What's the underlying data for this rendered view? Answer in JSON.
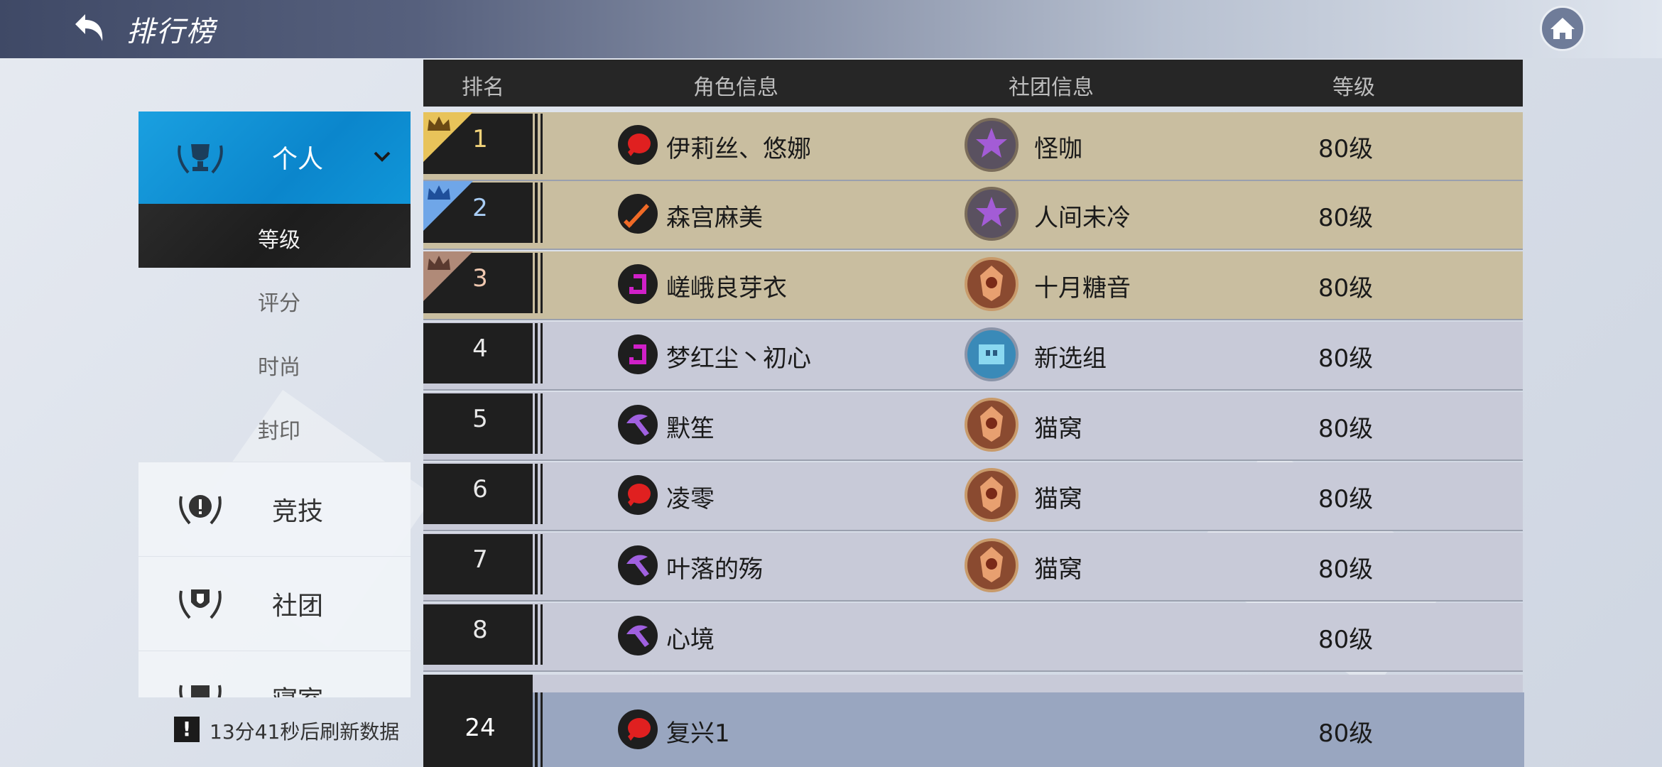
{
  "header": {
    "title": "排行榜",
    "back_icon": "back-arrow-icon",
    "home_icon": "home-icon"
  },
  "sidebar": {
    "personal_label": "个人",
    "subitems": [
      "等级",
      "评分",
      "时尚",
      "封印"
    ],
    "active_subitem": "等级",
    "categories": [
      "竞技",
      "社团",
      "寝室"
    ],
    "refresh_text": "13分41秒后刷新数据",
    "refresh_icon_text": "!"
  },
  "table": {
    "headers": {
      "rank": "排名",
      "role": "角色信息",
      "club": "社团信息",
      "level": "等级"
    },
    "rows": [
      {
        "rank": "1",
        "name": "伊莉丝、悠娜",
        "club": "怪咖",
        "level": "80级",
        "crown": "gold"
      },
      {
        "rank": "2",
        "name": "森宫麻美",
        "club": "人间未冷",
        "level": "80级",
        "crown": "blue"
      },
      {
        "rank": "3",
        "name": "嵯峨良芽衣",
        "club": "十月糖音",
        "level": "80级",
        "crown": "bronze"
      },
      {
        "rank": "4",
        "name": "梦红尘丶初心",
        "club": "新选组",
        "level": "80级"
      },
      {
        "rank": "5",
        "name": "默笙",
        "club": "猫窝",
        "level": "80级"
      },
      {
        "rank": "6",
        "name": "凌零",
        "club": "猫窝",
        "level": "80级"
      },
      {
        "rank": "7",
        "name": "叶落的殇",
        "club": "猫窝",
        "level": "80级"
      },
      {
        "rank": "8",
        "name": "心境",
        "club": "",
        "level": "80级"
      }
    ],
    "self_row": {
      "rank": "24",
      "name": "复兴1",
      "level": "80级"
    }
  },
  "colors": {
    "accent_blue": "#0b86cc",
    "gold": "#e8c35a",
    "blue_crown": "#6fa6e8",
    "bronze": "#b08a78"
  }
}
